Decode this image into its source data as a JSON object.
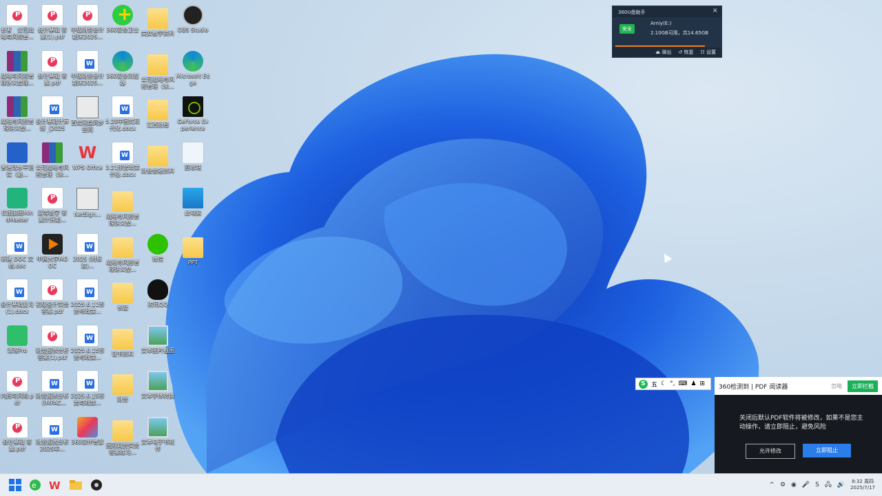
{
  "desktop_icons": [
    {
      "label": "长者　公司战略与风险管...",
      "type": "pdf"
    },
    {
      "label": "会计基础 答案(1).pdf",
      "type": "pdf"
    },
    {
      "label": "中级财务会计期末2025...",
      "type": "pdf"
    },
    {
      "label": "360安全卫士",
      "type": "360"
    },
    {
      "label": "美女教学资料",
      "type": "folder"
    },
    {
      "label": "OBS Studio",
      "type": "obs"
    },
    {
      "label": "战略与风险管理讲义整理...",
      "type": "rar"
    },
    {
      "label": "会计基础 答案.pdf",
      "type": "pdf"
    },
    {
      "label": "中级财务会计期末2025...",
      "type": "doc"
    },
    {
      "label": "360安全浏览器",
      "type": "edge"
    },
    {
      "label": "公司战略与风险管理（未...",
      "type": "folder"
    },
    {
      "label": "Microsoft Edge",
      "type": "edge"
    },
    {
      "label": "战略与风险管理讲义整...",
      "type": "rar"
    },
    {
      "label": "会计基础计算题（2025年...",
      "type": "doc"
    },
    {
      "label": "百度网盘同步空间",
      "type": "exe"
    },
    {
      "label": "5.28中国式现代化.docx",
      "type": "doc"
    },
    {
      "label": "江西财经",
      "type": "folder"
    },
    {
      "label": "GeForce Experience",
      "type": "nv"
    },
    {
      "label": "普通话水平测试（最...",
      "type": "blue"
    },
    {
      "label": "公司战略与风险管理（未...",
      "type": "rar"
    },
    {
      "label": "WPS Office",
      "type": "wps"
    },
    {
      "label": "3.21形势政策作业.docx",
      "type": "doc"
    },
    {
      "label": "财会金融资料",
      "type": "folder"
    },
    {
      "label": "回收站",
      "type": "bin"
    },
    {
      "label": "亿图脑图MindMaster",
      "type": "mm"
    },
    {
      "label": "高等数学 答案计算期...",
      "type": "pdf"
    },
    {
      "label": "NetSign...",
      "type": "exe"
    },
    {
      "label": "战略与风险管理讲义整...",
      "type": "folder"
    },
    {
      "label": "",
      "type": "none"
    },
    {
      "label": "此电脑",
      "type": "mon"
    },
    {
      "label": "新建 DOC 文档.doc",
      "type": "doc"
    },
    {
      "label": "中国大学MOOC",
      "type": "play"
    },
    {
      "label": "2025 (附标准)...",
      "type": "doc"
    },
    {
      "label": "战略与风险管理讲义整...",
      "type": "folder"
    },
    {
      "label": "微信",
      "type": "wx"
    },
    {
      "label": "PPT",
      "type": "folder"
    },
    {
      "label": "会计基础复习(1).docx",
      "type": "doc"
    },
    {
      "label": "初级会计实务答案.pdf",
      "type": "pdf"
    },
    {
      "label": "2025.6.11形势与政策...",
      "type": "doc"
    },
    {
      "label": "长盈",
      "type": "folder"
    },
    {
      "label": "腾讯QQ",
      "type": "qq"
    },
    {
      "label": "",
      "type": "none"
    },
    {
      "label": "清理Pro",
      "type": "green"
    },
    {
      "label": "财务报表分析答案(1).pdf",
      "type": "pdf"
    },
    {
      "label": "2025.6.15形势与政策...",
      "type": "doc"
    },
    {
      "label": "证书资料",
      "type": "folder"
    },
    {
      "label": "文本图片截图",
      "type": "img"
    },
    {
      "label": "",
      "type": "none"
    },
    {
      "label": "内控与风险.pdf",
      "type": "pdf"
    },
    {
      "label": "财务报表分析（IMPAC...",
      "type": "doc"
    },
    {
      "label": "2025.6.15形势与政策...",
      "type": "doc"
    },
    {
      "label": "财务",
      "type": "folder"
    },
    {
      "label": "文本字体转换",
      "type": "img"
    },
    {
      "label": "",
      "type": "none"
    },
    {
      "label": "会计基础 答案.pdf",
      "type": "pdf"
    },
    {
      "label": "财务报表分析2025年...",
      "type": "doc"
    },
    {
      "label": "360软件管家",
      "type": "gift"
    },
    {
      "label": "国际商务实务答案练习...",
      "type": "folder"
    },
    {
      "label": "文本电子书制作",
      "type": "img"
    },
    {
      "label": "",
      "type": "none"
    }
  ],
  "usb_widget": {
    "title": "360U盘助手",
    "close": "×",
    "badge": "安全",
    "device_name": "Arniy(E:)",
    "capacity": "2.10GB可用，共14.65GB",
    "actions": [
      "⏏ 弹出",
      "↺ 恢复",
      "☷ 设置"
    ]
  },
  "ime_bar": {
    "logo": "S",
    "items": [
      "五",
      "☾",
      "°,",
      "⌨",
      "♟",
      "⊞"
    ]
  },
  "pdf_popup": {
    "header_title": "360检测到 | PDF 阅读器",
    "ignore": "忽略",
    "block_top": "立即拦截",
    "message": "关闭后默认PDF软件将被修改，如果不是您主动操作，请立即阻止，避免风险",
    "allow": "允许修改",
    "stop": "立即阻止"
  },
  "taskbar": {
    "apps": [
      "start-icon",
      "360-browser-icon",
      "wps-icon",
      "file-explorer-icon",
      "obs-icon"
    ],
    "tray_icons": [
      "^",
      "⚙",
      "◉",
      "🎤",
      "S",
      "🖧",
      "🔊"
    ],
    "time": "8:32 周四",
    "date": "2025/7/17"
  },
  "colors": {
    "accent": "#2b7de9",
    "green": "#1ab05a",
    "taskbar": "#e9eef4"
  }
}
